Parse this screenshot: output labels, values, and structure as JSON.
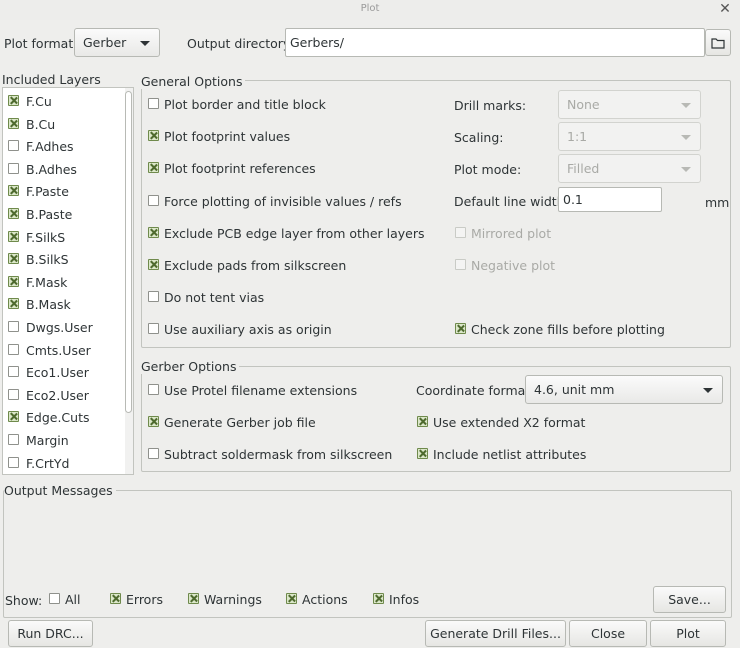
{
  "window": {
    "title": "Plot"
  },
  "plot_format": {
    "label": "Plot format:",
    "value": "Gerber"
  },
  "output_directory": {
    "label": "Output directory:",
    "value": "Gerbers/"
  },
  "layers": {
    "title": "Included Layers",
    "items": [
      {
        "name": "F.Cu",
        "checked": true
      },
      {
        "name": "B.Cu",
        "checked": true
      },
      {
        "name": "F.Adhes",
        "checked": false
      },
      {
        "name": "B.Adhes",
        "checked": false
      },
      {
        "name": "F.Paste",
        "checked": true
      },
      {
        "name": "B.Paste",
        "checked": true
      },
      {
        "name": "F.SilkS",
        "checked": true
      },
      {
        "name": "B.SilkS",
        "checked": true
      },
      {
        "name": "F.Mask",
        "checked": true
      },
      {
        "name": "B.Mask",
        "checked": true
      },
      {
        "name": "Dwgs.User",
        "checked": false
      },
      {
        "name": "Cmts.User",
        "checked": false
      },
      {
        "name": "Eco1.User",
        "checked": false
      },
      {
        "name": "Eco2.User",
        "checked": false
      },
      {
        "name": "Edge.Cuts",
        "checked": true
      },
      {
        "name": "Margin",
        "checked": false
      },
      {
        "name": "F.CrtYd",
        "checked": false
      }
    ]
  },
  "general": {
    "title": "General Options",
    "options": [
      {
        "label": "Plot border and title block",
        "checked": false
      },
      {
        "label": "Plot footprint values",
        "checked": true
      },
      {
        "label": "Plot footprint references",
        "checked": true
      },
      {
        "label": "Force plotting of invisible values / refs",
        "checked": false
      },
      {
        "label": "Exclude PCB edge layer from other layers",
        "checked": true
      },
      {
        "label": "Exclude pads from silkscreen",
        "checked": true
      },
      {
        "label": "Do not tent vias",
        "checked": false
      },
      {
        "label": "Use auxiliary axis as origin",
        "checked": false
      }
    ],
    "drill_marks": {
      "label": "Drill marks:",
      "value": "None"
    },
    "scaling": {
      "label": "Scaling:",
      "value": "1:1"
    },
    "plot_mode": {
      "label": "Plot mode:",
      "value": "Filled"
    },
    "line_width": {
      "label": "Default line width:",
      "value": "0.1",
      "unit": "mm"
    },
    "mirrored": {
      "label": "Mirrored plot",
      "checked": false
    },
    "negative": {
      "label": "Negative plot",
      "checked": false
    },
    "zone_fills": {
      "label": "Check zone fills before plotting",
      "checked": true
    }
  },
  "gerber": {
    "title": "Gerber Options",
    "options": [
      {
        "label": "Use Protel filename extensions",
        "checked": false
      },
      {
        "label": "Generate Gerber job file",
        "checked": true
      },
      {
        "label": "Subtract soldermask from silkscreen",
        "checked": false
      }
    ],
    "coord_format": {
      "label": "Coordinate format:",
      "value": "4.6, unit mm"
    },
    "x2": {
      "label": "Use extended X2 format",
      "checked": true
    },
    "netlist": {
      "label": "Include netlist attributes",
      "checked": true
    }
  },
  "messages": {
    "title": "Output Messages",
    "show_label": "Show:",
    "filters": [
      {
        "label": "All",
        "checked": false
      },
      {
        "label": "Errors",
        "checked": true
      },
      {
        "label": "Warnings",
        "checked": true
      },
      {
        "label": "Actions",
        "checked": true
      },
      {
        "label": "Infos",
        "checked": true
      }
    ],
    "save": "Save..."
  },
  "buttons": {
    "run_drc": "Run DRC...",
    "generate_drill": "Generate Drill Files...",
    "close": "Close",
    "plot": "Plot"
  },
  "icons": {
    "folder": "folder-icon",
    "close": "close-icon"
  },
  "colors": {
    "check_fill": "#dbe7c9",
    "check_mark": "#4e6a2e",
    "background": "#eeeeec"
  }
}
